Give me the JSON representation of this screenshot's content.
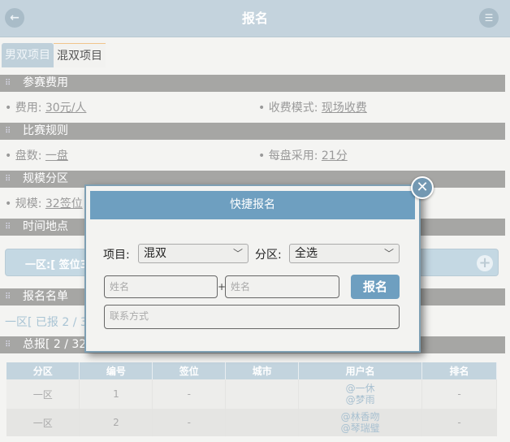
{
  "header": {
    "title": "报名",
    "back_icon": "←",
    "menu_icon": "☰"
  },
  "tabs": [
    {
      "label": "男双项目"
    },
    {
      "label": "混双项目"
    }
  ],
  "sections": {
    "fee": {
      "title": "参赛费用"
    },
    "rules": {
      "title": "比赛规则"
    },
    "scale": {
      "title": "规模分区"
    },
    "place": {
      "title": "时间地点"
    },
    "list": {
      "title": "报名名单"
    },
    "total": {
      "title": "总报[ 2 / 32"
    }
  },
  "fee": {
    "fee_label": "费用:",
    "fee_value": "30元/人",
    "mode_label": "收费模式:",
    "mode_value": "现场收费"
  },
  "rules": {
    "sets_label": "盘数:",
    "sets_value": "一盘",
    "per_label": "每盘采用:",
    "per_value": "21分"
  },
  "scale": {
    "size_label": "规模:",
    "size_value": "32签位"
  },
  "zone_bar": {
    "text": "一区:[ 签位32"
  },
  "reg_info": "一区[ 已报 2 / 3",
  "table": {
    "headers": [
      "分区",
      "编号",
      "签位",
      "城市",
      "用户名",
      "排名"
    ],
    "rows": [
      {
        "zone": "一区",
        "no": "1",
        "seed": "-",
        "city": "",
        "user1": "@一休",
        "user2": "@梦雨",
        "rank": "-"
      },
      {
        "zone": "一区",
        "no": "2",
        "seed": "-",
        "city": "",
        "user1": "@林香吻",
        "user2": "@琴瑞璧",
        "rank": "-"
      }
    ]
  },
  "modal": {
    "title": "快捷报名",
    "project_label": "项目:",
    "project_value": "混双",
    "zone_label": "分区:",
    "zone_value": "全选",
    "name1_placeholder": "姓名",
    "name2_placeholder": "姓名",
    "contact_placeholder": "联系方式",
    "submit_label": "报名",
    "plus": "+"
  }
}
